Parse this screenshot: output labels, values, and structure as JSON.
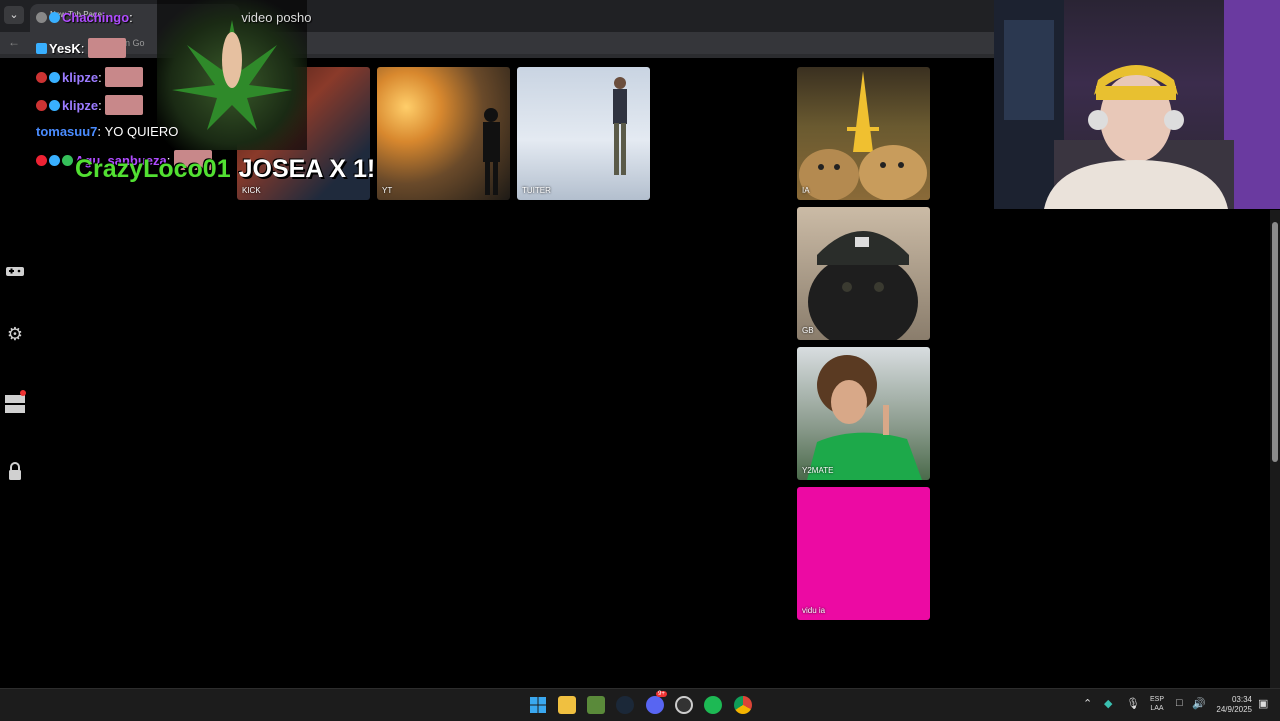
{
  "browser": {
    "tab_title": "New Tab Page",
    "omnibox_text": "en Go"
  },
  "tiles": [
    {
      "label": "KICK"
    },
    {
      "label": "YT"
    },
    {
      "label": "TUITER"
    },
    {
      "label": "IA"
    },
    {
      "label": "GB"
    },
    {
      "label": "Y2MATE"
    },
    {
      "label": "vidu ia"
    }
  ],
  "chat": [
    {
      "user": "Chachingo",
      "message": "video posho",
      "user_color": "#b04cff"
    },
    {
      "user": "YesK",
      "message": "",
      "user_color": "#ffffff"
    },
    {
      "user": "klipze",
      "message": "",
      "user_color": "#9b7bff"
    },
    {
      "user": "klipze",
      "message": "",
      "user_color": "#9b7bff"
    },
    {
      "user": "tomasuu7",
      "message": "YO QUIERO",
      "user_color": "#4a8cff"
    },
    {
      "user": "Agu_sanbueza",
      "message": "",
      "user_color": "#b04cff"
    }
  ],
  "alert": {
    "name": "CrazyLoco01",
    "text": "JOSEA X 1!"
  },
  "taskbar": {
    "language": [
      "ESP",
      "LAA"
    ],
    "time": "03:34",
    "date": "24/9/2025",
    "discord_badge": "9+"
  },
  "colors": {
    "accent_pink": "#ec0aa3",
    "alert_green": "#52e032"
  },
  "icons": [
    "chevron-down-icon",
    "back-arrow-icon",
    "gamepad-icon",
    "gear-icon",
    "list-icon",
    "lock-icon",
    "windows-start-icon",
    "file-explorer-icon",
    "minecraft-icon",
    "steam-icon",
    "discord-icon",
    "obs-icon",
    "spotify-icon",
    "chrome-icon"
  ]
}
